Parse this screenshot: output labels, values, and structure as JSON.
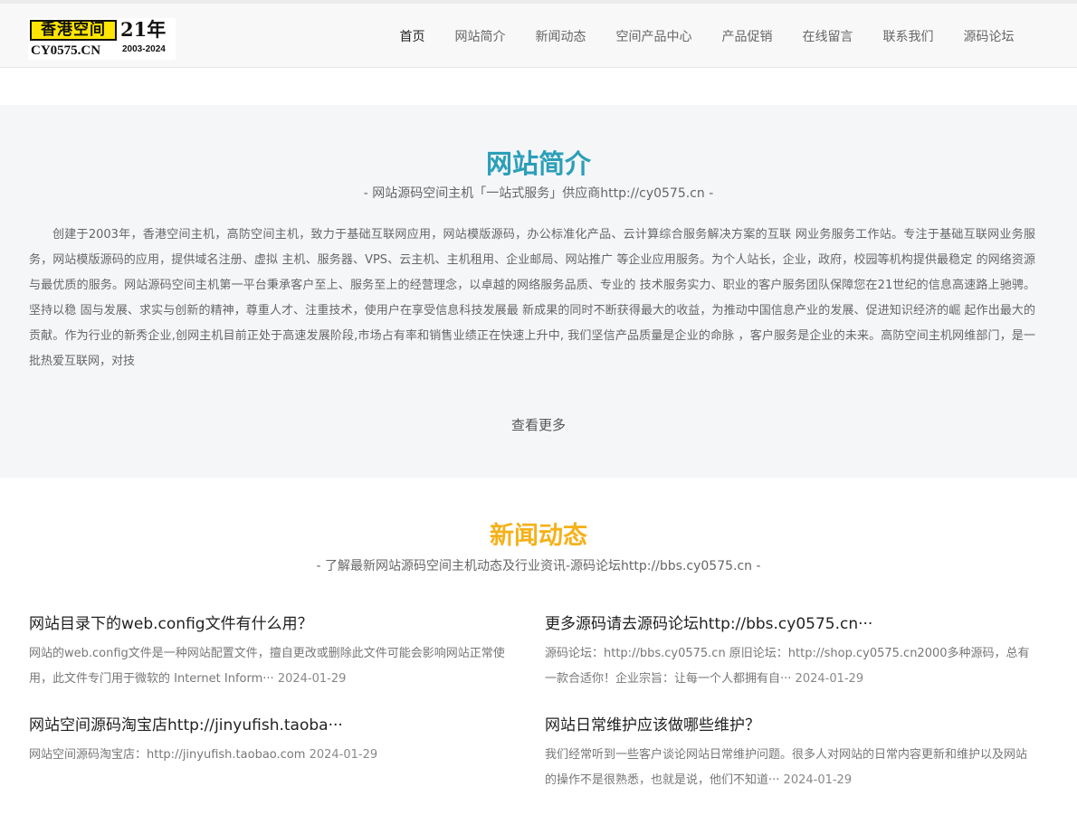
{
  "logo": {
    "badge_text": "香港空间",
    "year_text": "21年",
    "domain_text": "CY0575.CN",
    "range_text": "2003-2024",
    "accent_color": "#ffe500"
  },
  "nav": {
    "items": [
      {
        "label": "首页",
        "active": true
      },
      {
        "label": "网站简介"
      },
      {
        "label": "新闻动态"
      },
      {
        "label": "空间产品中心"
      },
      {
        "label": "产品促销"
      },
      {
        "label": "在线留言"
      },
      {
        "label": "联系我们"
      },
      {
        "label": "源码论坛"
      }
    ]
  },
  "about": {
    "title": "网站简介",
    "subtitle": "- 网站源码空间主机「一站式服务」供应商http://cy0575.cn -",
    "text": "创建于2003年，香港空间主机，高防空间主机，致力于基础互联网应用，网站模版源码，办公标准化产品、云计算综合服务解决方案的互联 网业务服务工作站。专注于基础互联网业务服务，网站模版源码的应用，提供域名注册、虚拟 主机、服务器、VPS、云主机、主机租用、企业邮局、网站推广 等企业应用服务。为个人站长，企业，政府，校园等机构提供最稳定 的网络资源与最优质的服务。网站源码空间主机第一平台秉承客户至上、服务至上的经营理念，以卓越的网络服务品质、专业的 技术服务实力、职业的客户服务团队保障您在21世纪的信息高速路上驰骋。坚持以稳 固与发展、求实与创新的精神，尊重人才、注重技术，使用户在享受信息科技发展最 新成果的同时不断获得最大的收益，为推动中国信息产业的发展、促进知识经济的崛 起作出最大的贡献。作为行业的新秀企业,创网主机目前正处于高速发展阶段,市场占有率和销售业绩正在快速上升中, 我们坚信产品质量是企业的命脉 ，客户服务是企业的未来。高防空间主机网维部门，是一批热爱互联网，对技",
    "more_label": "查看更多",
    "title_color": "#2b9fb8"
  },
  "news": {
    "title": "新闻动态",
    "subtitle": "- 了解最新网站源码空间主机动态及行业资讯-源码论坛http://bbs.cy0575.cn -",
    "title_color": "#f5b11a",
    "items": [
      {
        "title": "网站目录下的web.config文件有什么用？",
        "desc": "网站的web.config文件是一种网站配置文件，擅自更改或删除此文件可能会影响网站正常使用，此文件专门用于微软的 Internet Inform···",
        "date": "2024-01-29"
      },
      {
        "title": "更多源码请去源码论坛http://bbs.cy0575.cn···",
        "desc": "源码论坛：http://bbs.cy0575.cn 原旧论坛：http://shop.cy0575.cn2000多种源码，总有一款合适你！企业宗旨：让每一个人都拥有自···",
        "date": "2024-01-29"
      },
      {
        "title": "网站空间源码淘宝店http://jinyufish.taoba···",
        "desc": "网站空间源码淘宝店：http://jinyufish.taobao.com",
        "date": "2024-01-29"
      },
      {
        "title": "网站日常维护应该做哪些维护？",
        "desc": "我们经常听到一些客户谈论网站日常维护问题。很多人对网站的日常内容更新和维护以及网站的操作不是很熟悉，也就是说，他们不知道···",
        "date": "2024-01-29"
      }
    ]
  }
}
